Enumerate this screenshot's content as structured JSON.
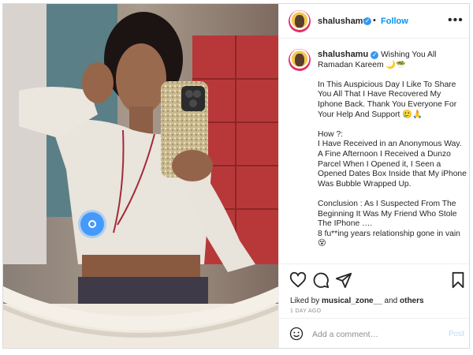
{
  "post": {
    "username": "shalushamu",
    "follow_label": "Follow",
    "separator": "•",
    "more_label": "•••",
    "verified_mark": "✓"
  },
  "caption": {
    "username": "shalushamu",
    "line1": "Wishing You All Ramadan Kareem 🌙🥗",
    "para1": "In This Auspicious Day I Like To Share You All That I Have Recovered My Iphone Back. Thank You Everyone For Your Help And Support 🥲🙏",
    "para2": "How ?:\nI Have Received in an Anonymous Way. A Fine Afternoon I Received a Dunzo Parcel When I Opened it, I Seen a Opened Dates Box Inside that My iPhone Was Bubble Wrapped Up.",
    "para3": "Conclusion : As I Suspected From The Beginning It Was My Friend Who Stole The IPhone ….\n8 fu**ing years relationship gone in vain 😵"
  },
  "likes": {
    "prefix": "Liked by",
    "user": "musical_zone__",
    "conj": "and",
    "others": "others"
  },
  "time": "1 DAY AGO",
  "comment": {
    "placeholder": "Add a comment…",
    "post_label": "Post"
  },
  "icons": [
    "heart-icon",
    "comment-icon",
    "share-icon",
    "save-icon",
    "emoji-icon",
    "more-icon",
    "verified-icon"
  ],
  "colors": {
    "accent": "#0095f6",
    "post_disabled": "#b2dffc",
    "verified": "#3897f0",
    "text": "#262626",
    "muted": "#8e8e8e"
  }
}
